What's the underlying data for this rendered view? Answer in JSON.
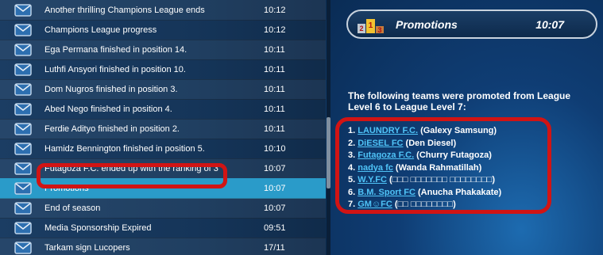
{
  "messages": [
    {
      "text": "Another thrilling Champions League ends",
      "time": "10:12"
    },
    {
      "text": "Champions League progress",
      "time": "10:12"
    },
    {
      "text": "Ega Permana finished in position 14.",
      "time": "10:11"
    },
    {
      "text": "Luthfi Ansyori finished in position 10.",
      "time": "10:11"
    },
    {
      "text": "Dom Nugros finished in position 3.",
      "time": "10:11"
    },
    {
      "text": "Abed Nego finished in position 4.",
      "time": "10:11"
    },
    {
      "text": "Ferdie Adityo finished in position 2.",
      "time": "10:11"
    },
    {
      "text": "Hamidz Bennington finished in position 5.",
      "time": "10:10"
    },
    {
      "text": "Futagoza F.C. ended up with the ranking of 3",
      "time": "10:07"
    },
    {
      "text": "Promotions",
      "time": "10:07"
    },
    {
      "text": "End of season",
      "time": "10:07"
    },
    {
      "text": "Media Sponsorship Expired",
      "time": "09:51"
    },
    {
      "text": "Tarkam sign Lucopers",
      "time": "17/11"
    }
  ],
  "detail": {
    "title": "Promotions",
    "time": "10:07",
    "intro": "The following teams were promoted from League Level 6 to League Level 7:",
    "teams": [
      {
        "num": "1.",
        "name": "LAUNDRY F.C.",
        "owner": "(Galexy Samsung)"
      },
      {
        "num": "2.",
        "name": "DiESEL FC",
        "owner": "(Den Diesel)"
      },
      {
        "num": "3.",
        "name": "Futagoza F.C.",
        "owner": "(Churry Futagoza)"
      },
      {
        "num": "4.",
        "name": "nadya fc",
        "owner": "(Wanda Rahmatillah)"
      },
      {
        "num": "5.",
        "name": "W.Y.FC",
        "owner": "(□□□ □□□□□□□ □□□□□□□□)"
      },
      {
        "num": "6.",
        "name": "B.M. Sport FC",
        "owner": "(Anucha Phakakate)"
      },
      {
        "num": "7.",
        "name": "GM☺FC",
        "owner": "(□□ □□□□□□□□)"
      }
    ]
  },
  "colors": {
    "selected_row": "#2a9bc9",
    "link": "#4fc3f7",
    "annotation": "#d11414"
  },
  "icons": {
    "message_icon": "envelope-icon",
    "header_icon": "trophy-podium-icon"
  }
}
